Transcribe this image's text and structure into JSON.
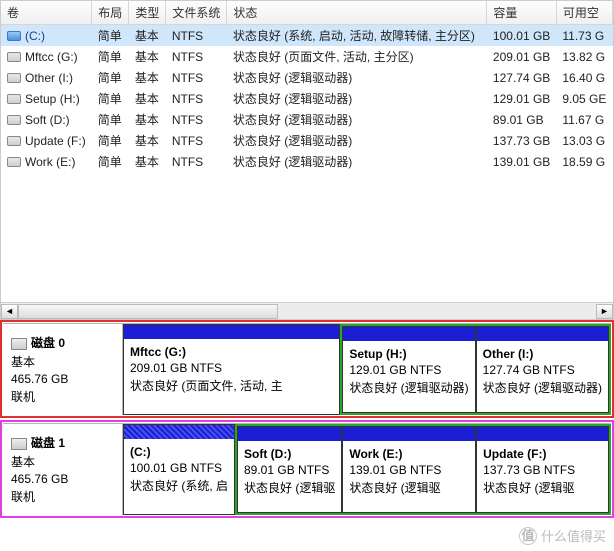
{
  "columns": {
    "c0": "卷",
    "c1": "布局",
    "c2": "类型",
    "c3": "文件系统",
    "c4": "状态",
    "c5": "容量",
    "c6": "可用空"
  },
  "rows": [
    {
      "name": "(C:)",
      "layout": "简单",
      "type": "基本",
      "fs": "NTFS",
      "status": "状态良好 (系统, 启动, 活动, 故障转储, 主分区)",
      "cap": "100.01 GB",
      "free": "11.73 G",
      "sel": true,
      "blue": true
    },
    {
      "name": "Mftcc (G:)",
      "layout": "简单",
      "type": "基本",
      "fs": "NTFS",
      "status": "状态良好 (页面文件, 活动, 主分区)",
      "cap": "209.01 GB",
      "free": "13.82 G"
    },
    {
      "name": "Other (I:)",
      "layout": "简单",
      "type": "基本",
      "fs": "NTFS",
      "status": "状态良好 (逻辑驱动器)",
      "cap": "127.74 GB",
      "free": "16.40 G"
    },
    {
      "name": "Setup (H:)",
      "layout": "简单",
      "type": "基本",
      "fs": "NTFS",
      "status": "状态良好 (逻辑驱动器)",
      "cap": "129.01 GB",
      "free": "9.05 GE"
    },
    {
      "name": "Soft (D:)",
      "layout": "简单",
      "type": "基本",
      "fs": "NTFS",
      "status": "状态良好 (逻辑驱动器)",
      "cap": "89.01 GB",
      "free": "11.67 G"
    },
    {
      "name": "Update (F:)",
      "layout": "简单",
      "type": "基本",
      "fs": "NTFS",
      "status": "状态良好 (逻辑驱动器)",
      "cap": "137.73 GB",
      "free": "13.03 G"
    },
    {
      "name": "Work (E:)",
      "layout": "简单",
      "type": "基本",
      "fs": "NTFS",
      "status": "状态良好 (逻辑驱动器)",
      "cap": "139.01 GB",
      "free": "18.59 G"
    }
  ],
  "disk0": {
    "title": "磁盘 0",
    "type": "基本",
    "size": "465.76 GB",
    "status": "联机",
    "parts": [
      {
        "name": "Mftcc  (G:)",
        "info": "209.01 GB NTFS",
        "status": "状态良好 (页面文件, 活动, 主"
      },
      {
        "name": "Setup  (H:)",
        "info": "129.01 GB NTFS",
        "status": "状态良好 (逻辑驱动器)"
      },
      {
        "name": "Other  (I:)",
        "info": "127.74 GB NTFS",
        "status": "状态良好 (逻辑驱动器)"
      }
    ]
  },
  "disk1": {
    "title": "磁盘 1",
    "type": "基本",
    "size": "465.76 GB",
    "status": "联机",
    "parts": [
      {
        "name": "(C:)",
        "info": "100.01 GB NTFS",
        "status": "状态良好 (系统, 启",
        "hatched": true
      },
      {
        "name": "Soft  (D:)",
        "info": "89.01 GB NTFS",
        "status": "状态良好 (逻辑驱"
      },
      {
        "name": "Work  (E:)",
        "info": "139.01 GB NTFS",
        "status": "状态良好 (逻辑驱"
      },
      {
        "name": "Update  (F:)",
        "info": "137.73 GB NTFS",
        "status": "状态良好 (逻辑驱"
      }
    ]
  },
  "watermark": {
    "char": "值",
    "text": "什么值得买"
  }
}
